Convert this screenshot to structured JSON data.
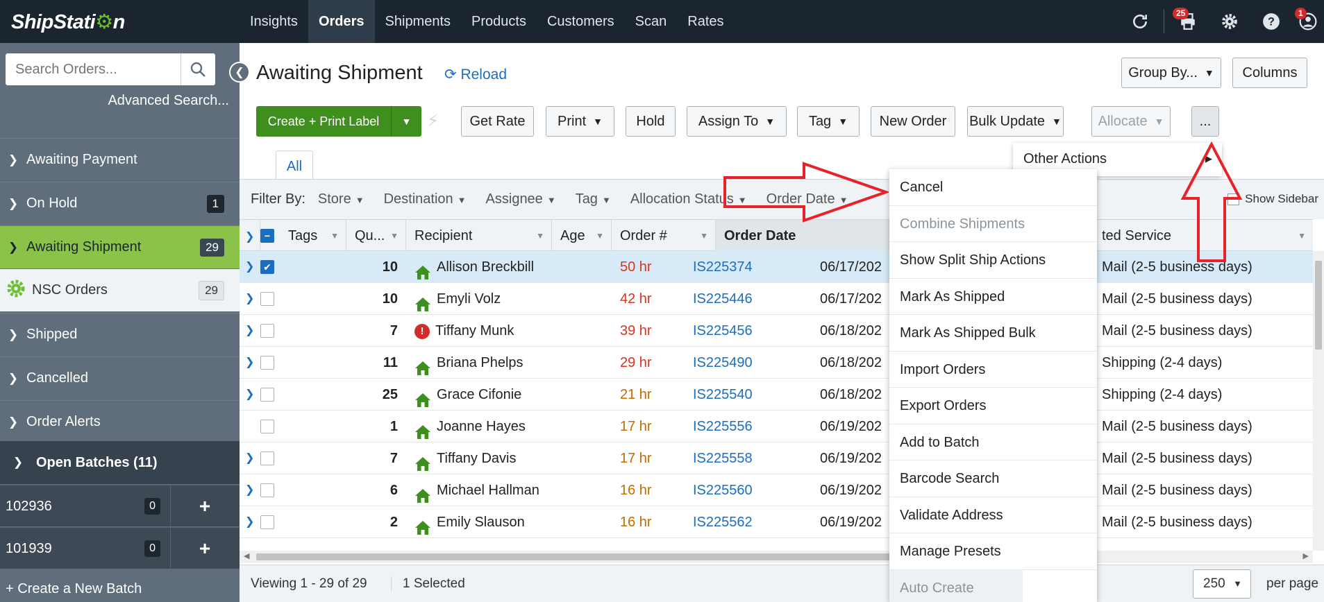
{
  "logo": {
    "text_before": "ShipStati",
    "text_gear": "⚙",
    "text_after": "n"
  },
  "nav": {
    "tabs": [
      {
        "label": "Insights"
      },
      {
        "label": "Orders"
      },
      {
        "label": "Shipments"
      },
      {
        "label": "Products"
      },
      {
        "label": "Customers"
      },
      {
        "label": "Scan"
      },
      {
        "label": "Rates"
      }
    ],
    "print_badge": "25",
    "account_badge": "1"
  },
  "sidebar": {
    "search_placeholder": "Search Orders...",
    "advanced_search": "Advanced Search...",
    "items": [
      {
        "label": "Awaiting Payment",
        "count": ""
      },
      {
        "label": "On Hold",
        "count": "1"
      },
      {
        "label": "Awaiting Shipment",
        "count": "29"
      },
      {
        "label": "NSC Orders",
        "count": "29"
      },
      {
        "label": "Shipped",
        "count": ""
      },
      {
        "label": "Cancelled",
        "count": ""
      },
      {
        "label": "Order Alerts",
        "count": ""
      }
    ],
    "batches_title": "Open Batches (11)",
    "batches": [
      {
        "id": "102936",
        "count": "0"
      },
      {
        "id": "101939",
        "count": "0"
      }
    ],
    "create_batch": "+ Create a New Batch"
  },
  "main": {
    "title": "Awaiting Shipment",
    "reload": "Reload",
    "group_by": "Group By...",
    "columns": "Columns",
    "toolbar": {
      "create_print": "Create + Print Label",
      "get_rate": "Get Rate",
      "print": "Print",
      "hold": "Hold",
      "assign_to": "Assign To",
      "tag": "Tag",
      "new_order": "New Order",
      "bulk_update": "Bulk Update",
      "allocate": "Allocate",
      "more": "..."
    },
    "tab_all": "All",
    "filter_label": "Filter By:",
    "filters": [
      "Store",
      "Destination",
      "Assignee",
      "Tag",
      "Allocation Status",
      "Order Date"
    ],
    "show_sidebar": "Show Sidebar"
  },
  "table": {
    "headers": {
      "tags": "Tags",
      "qty": "Qu...",
      "recipient": "Recipient",
      "age": "Age",
      "order": "Order #",
      "order_date": "Order Date",
      "service": "ted Service"
    },
    "rows": [
      {
        "qty": "10",
        "icon": "house",
        "recipient": "Allison Breckbill",
        "age": "50 hr",
        "age_color": "red",
        "order": "IS225374",
        "date": "06/17/202",
        "service": "Mail (2-5 business days)",
        "checked": true,
        "expander": true
      },
      {
        "qty": "10",
        "icon": "house",
        "recipient": "Emyli Volz",
        "age": "42 hr",
        "age_color": "red",
        "order": "IS225446",
        "date": "06/17/202",
        "service": "Mail (2-5 business days)",
        "checked": false,
        "expander": true
      },
      {
        "qty": "7",
        "icon": "alert",
        "recipient": "Tiffany Munk",
        "age": "39 hr",
        "age_color": "red",
        "order": "IS225456",
        "date": "06/18/202",
        "service": "Mail (2-5 business days)",
        "checked": false,
        "expander": true
      },
      {
        "qty": "11",
        "icon": "house",
        "recipient": "Briana Phelps",
        "age": "29 hr",
        "age_color": "red",
        "order": "IS225490",
        "date": "06/18/202",
        "service": "Shipping (2-4 days)",
        "checked": false,
        "expander": true
      },
      {
        "qty": "25",
        "icon": "house",
        "recipient": "Grace Cifonie",
        "age": "21 hr",
        "age_color": "orange",
        "order": "IS225540",
        "date": "06/18/202",
        "service": "Shipping (2-4 days)",
        "checked": false,
        "expander": true
      },
      {
        "qty": "1",
        "icon": "house",
        "recipient": "Joanne Hayes",
        "age": "17 hr",
        "age_color": "orange",
        "order": "IS225556",
        "date": "06/19/202",
        "service": "Mail (2-5 business days)",
        "checked": false,
        "expander": false
      },
      {
        "qty": "7",
        "icon": "house",
        "recipient": "Tiffany Davis",
        "age": "17 hr",
        "age_color": "orange",
        "order": "IS225558",
        "date": "06/19/202",
        "service": "Mail (2-5 business days)",
        "checked": false,
        "expander": true
      },
      {
        "qty": "6",
        "icon": "house",
        "recipient": "Michael Hallman",
        "age": "16 hr",
        "age_color": "orange",
        "order": "IS225560",
        "date": "06/19/202",
        "service": "Mail (2-5 business days)",
        "checked": false,
        "expander": true
      },
      {
        "qty": "2",
        "icon": "house",
        "recipient": "Emily Slauson",
        "age": "16 hr",
        "age_color": "orange",
        "order": "IS225562",
        "date": "06/19/202",
        "service": "Mail (2-5 business days)",
        "checked": false,
        "expander": true
      }
    ]
  },
  "footer": {
    "viewing": "Viewing 1 - 29 of 29",
    "selected": "1 Selected",
    "per_page_value": "250",
    "per_page_label": "per page"
  },
  "dropdown": {
    "other_actions": "Other Actions",
    "items": [
      {
        "label": "Cancel",
        "disabled": false
      },
      {
        "label": "Combine Shipments",
        "disabled": true
      },
      {
        "label": "Show Split Ship Actions",
        "disabled": false
      },
      {
        "label": "Mark As Shipped",
        "disabled": false
      },
      {
        "label": "Mark As Shipped Bulk",
        "disabled": false
      },
      {
        "label": "Import Orders",
        "disabled": false
      },
      {
        "label": "Export Orders",
        "disabled": false
      },
      {
        "label": "Add to Batch",
        "disabled": false
      },
      {
        "label": "Barcode Search",
        "disabled": false
      },
      {
        "label": "Validate Address",
        "disabled": false
      },
      {
        "label": "Manage Presets",
        "disabled": false
      }
    ],
    "last_item": "Auto Create Batches"
  },
  "colors": {
    "nav_bg": "#1b2530",
    "sidebar_bg": "#5f6e7a",
    "active_green": "#8bc34a",
    "primary_green": "#3f8f1f",
    "link_blue": "#1a6ec2",
    "annotation_red": "#e8222a"
  }
}
